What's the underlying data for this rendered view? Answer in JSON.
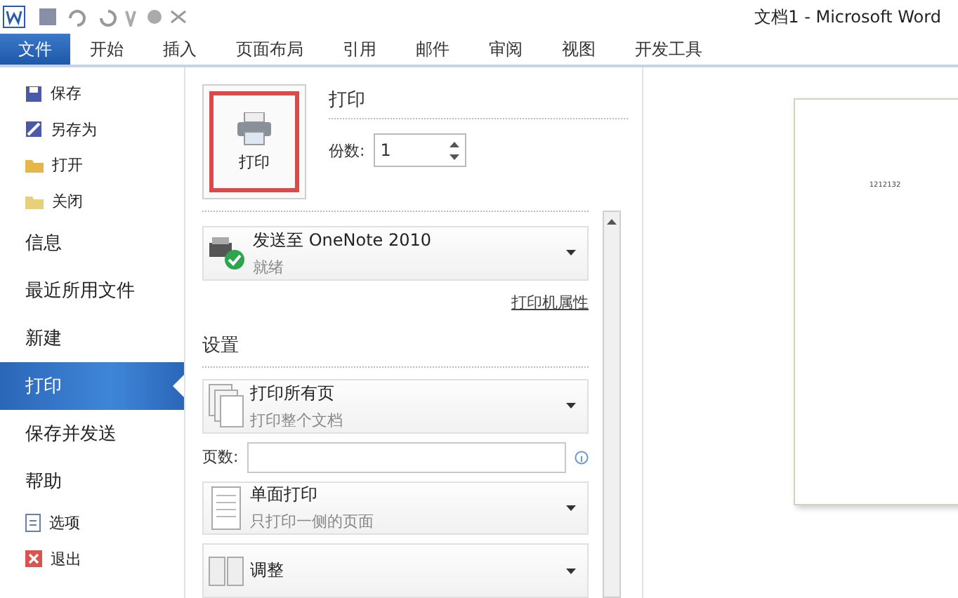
{
  "window": {
    "title": "文档1 - Microsoft Word"
  },
  "ribbon_tabs": [
    {
      "label": "文件",
      "selected": true
    },
    {
      "label": "开始",
      "selected": false
    },
    {
      "label": "插入",
      "selected": false
    },
    {
      "label": "页面布局",
      "selected": false
    },
    {
      "label": "引用",
      "selected": false
    },
    {
      "label": "邮件",
      "selected": false
    },
    {
      "label": "审阅",
      "selected": false
    },
    {
      "label": "视图",
      "selected": false
    },
    {
      "label": "开发工具",
      "selected": false
    }
  ],
  "nav": [
    {
      "label": "保存",
      "kind": "command",
      "selected": false
    },
    {
      "label": "另存为",
      "kind": "command",
      "selected": false
    },
    {
      "label": "打开",
      "kind": "command",
      "selected": false
    },
    {
      "label": "关闭",
      "kind": "command",
      "selected": false
    },
    {
      "label": "信息",
      "kind": "section",
      "selected": false
    },
    {
      "label": "最近所用文件",
      "kind": "section",
      "selected": false
    },
    {
      "label": "新建",
      "kind": "section",
      "selected": false
    },
    {
      "label": "打印",
      "kind": "section",
      "selected": true
    },
    {
      "label": "保存并发送",
      "kind": "section",
      "selected": false
    },
    {
      "label": "帮助",
      "kind": "section",
      "selected": false
    },
    {
      "label": "选项",
      "kind": "command",
      "selected": false
    },
    {
      "label": "退出",
      "kind": "command",
      "selected": false
    }
  ],
  "print": {
    "heading": "打印",
    "button": "打印",
    "copies_label": "份数:",
    "copies": "1"
  },
  "printer": {
    "name": "发送至 OneNote 2010",
    "status": "就绪",
    "properties_link": "打印机属性"
  },
  "settings": {
    "heading": "设置",
    "items": [
      {
        "kind": "dropdown",
        "title": "打印所有页",
        "subtitle": "打印整个文档"
      },
      {
        "kind": "pages",
        "label": "页数:"
      },
      {
        "kind": "dropdown",
        "title": "单面打印",
        "subtitle": "只打印一侧的页面"
      },
      {
        "kind": "dropdown",
        "title": "调整"
      }
    ]
  },
  "preview": {
    "page_text": "1212132"
  }
}
